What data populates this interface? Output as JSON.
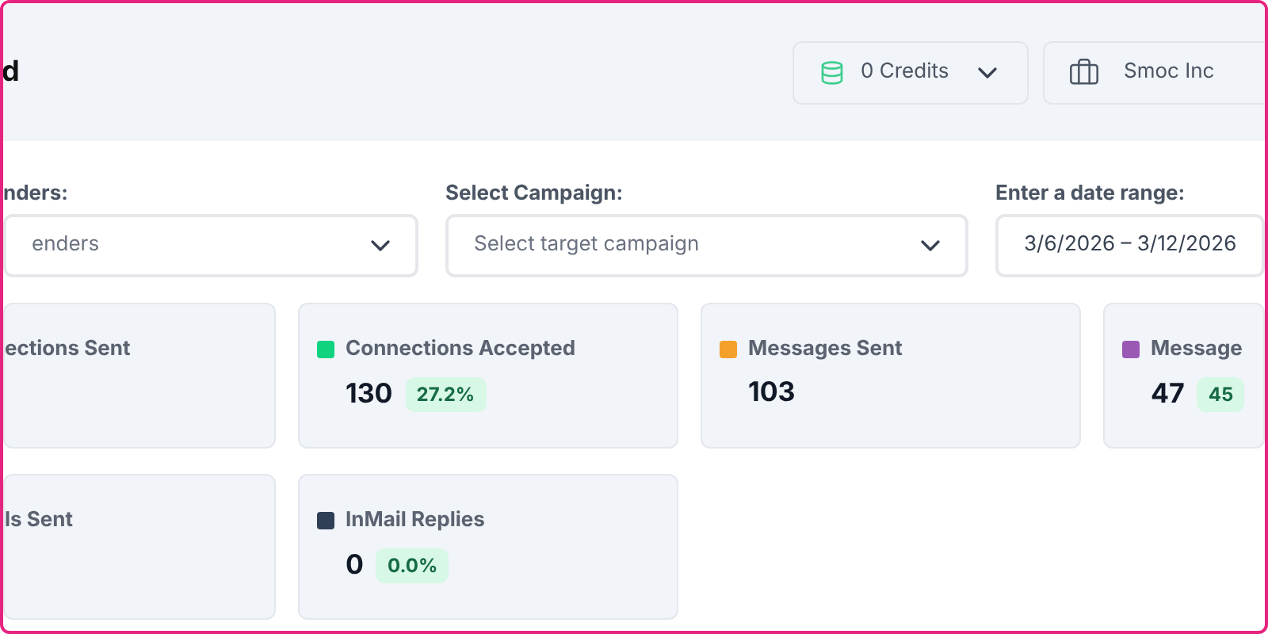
{
  "header": {
    "title": "d",
    "credits": {
      "label": "0 Credits"
    },
    "company": {
      "label": "Smoc Inc"
    }
  },
  "filters": [
    {
      "label": "nders:",
      "placeholder": "enders",
      "kind": "select"
    },
    {
      "label": "Select Campaign:",
      "placeholder": "Select target campaign",
      "kind": "select"
    },
    {
      "label": "Enter a date range:",
      "value": "3/6/2026 – 3/12/2026",
      "kind": "date"
    }
  ],
  "stats": [
    {
      "title": "ections Sent"
    },
    {
      "title": "Connections Accepted",
      "color": "#10d37f",
      "value": "130",
      "rate": "27.2%"
    },
    {
      "title": "Messages Sent",
      "color": "#f4a02a",
      "value": "103"
    },
    {
      "title": "Message",
      "color": "#9b59b6",
      "value": "47",
      "rate": "45"
    },
    {
      "title": "ls Sent"
    },
    {
      "title": "InMail Replies",
      "color": "#2e3f56",
      "value": "0",
      "rate": "0.0%"
    }
  ]
}
